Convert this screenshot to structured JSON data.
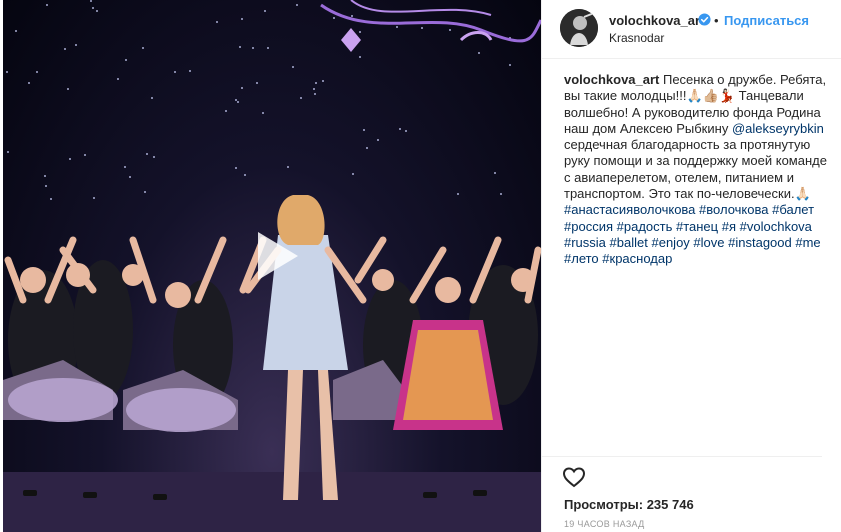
{
  "post": {
    "username": "volochkova_art",
    "dot": "•",
    "follow_label": "Подписаться",
    "location": "Krasnodar"
  },
  "caption": {
    "username": "volochkova_art",
    "text1": " Песенка о дружбе. Ребята, вы такие молодцы!!!🙏🏻👍🏼💃🏻 Танцевали волшебно! А руководителю фонда Родина наш дом Алексею Рыбкину ",
    "mention": "@alekseyrybkin",
    "text2": " сердечная благодарность за протянутую руку помощи и за поддержку моей команде с авиаперелетом, отелем, питанием и транспортом. Это так по-человечески.🙏🏻 ",
    "hashtags": [
      "#анастасияволочкова",
      "#волочкова",
      "#балет",
      "#россия",
      "#радость",
      "#танец",
      "#я",
      "#volochkova",
      "#russia",
      "#ballet",
      "#enjoy",
      "#love",
      "#instagood",
      "#me",
      "#лето",
      "#краснодар"
    ]
  },
  "stats": {
    "views": "Просмотры: 235 746",
    "time": "19 часов назад"
  },
  "icons": {
    "verified": "verified-badge-icon",
    "heart": "heart-icon",
    "play": "play-icon"
  },
  "colors": {
    "link": "#003569",
    "follow": "#3897f0",
    "verified": "#3897f0"
  }
}
